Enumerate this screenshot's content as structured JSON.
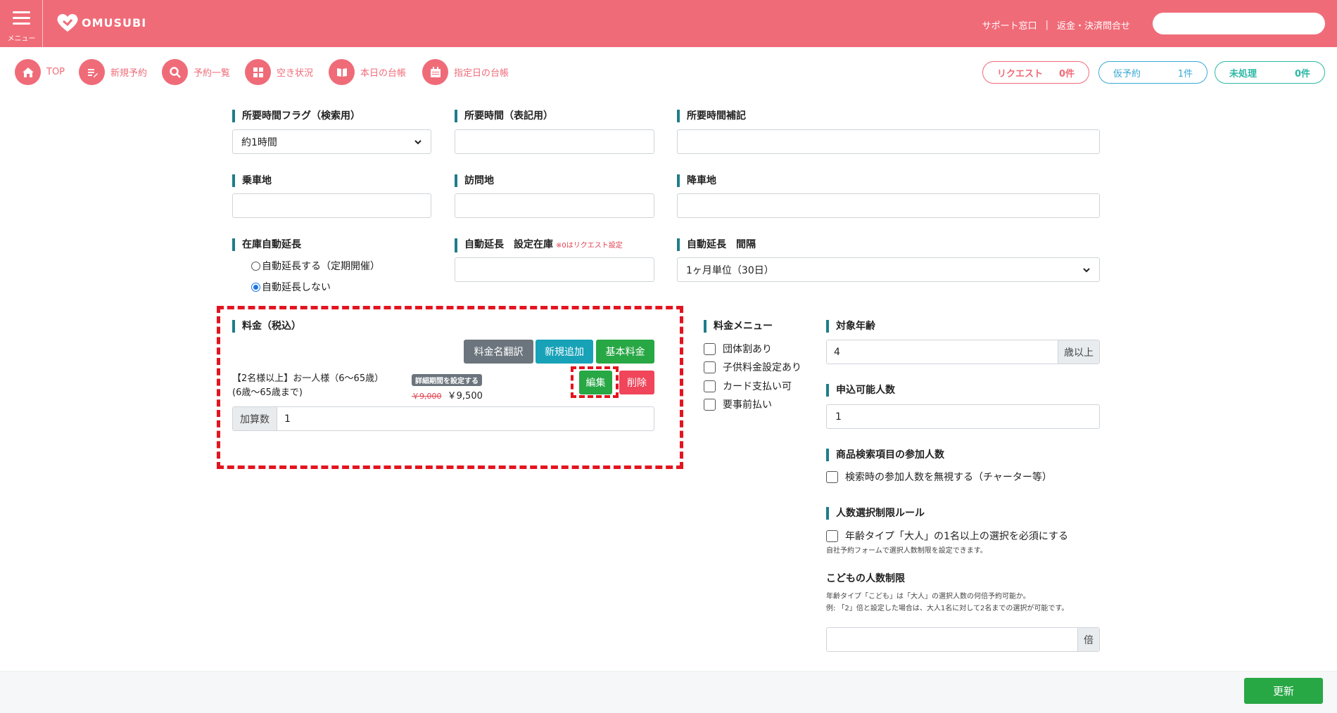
{
  "header": {
    "menu_label": "メニュー",
    "logo_text": "OMUSUBI",
    "support_link": "サポート窓口",
    "refund_link": "返金・決済問合せ",
    "search_value": "",
    "brand_color": "#f06b78"
  },
  "nav": {
    "items": [
      {
        "label": "TOP",
        "icon": "home-icon"
      },
      {
        "label": "新規予約",
        "icon": "edit-icon"
      },
      {
        "label": "予約一覧",
        "icon": "search-icon"
      },
      {
        "label": "空き状況",
        "icon": "grid-icon"
      },
      {
        "label": "本日の台帳",
        "icon": "book-icon"
      },
      {
        "label": "指定日の台帳",
        "icon": "calendar-icon"
      }
    ],
    "status": {
      "request_label": "リクエスト",
      "request_count": "0件",
      "tentative_label": "仮予約",
      "tentative_count": "1件",
      "unprocessed_label": "未処理",
      "unprocessed_count": "0件"
    }
  },
  "form": {
    "duration_flag_label": "所要時間フラグ（検索用）",
    "duration_flag_value": "約1時間",
    "duration_display_label": "所要時間（表記用）",
    "duration_display_value": "",
    "duration_note_label": "所要時間補記",
    "duration_note_value": "",
    "boarding_label": "乗車地",
    "boarding_value": "",
    "visit_label": "訪問地",
    "visit_value": "",
    "alighting_label": "降車地",
    "alighting_value": "",
    "auto_extend_label": "在庫自動延長",
    "auto_extend_on": "自動延長する（定期開催）",
    "auto_extend_off": "自動延長しない",
    "auto_stock_label": "自動延長　設定在庫",
    "auto_stock_note": "※0はリクエスト設定",
    "auto_stock_value": "",
    "auto_interval_label": "自動延長　間隔",
    "auto_interval_value": "1ヶ月単位（30日）"
  },
  "price": {
    "section_label": "料金（税込）",
    "translate_button": "料金名翻訳",
    "add_button": "新規追加",
    "base_button": "基本料金",
    "item_name": "【2名様以上】お一人様（6〜65歳）",
    "item_sub": "(6歳〜65歳まで)",
    "detail_badge": "詳細期間を設定する",
    "original_price": "￥9,000",
    "price": "￥9,500",
    "edit_button": "編集",
    "delete_button": "削除",
    "count_label": "加算数",
    "count_value": "1"
  },
  "price_menu": {
    "label": "料金メニュー",
    "options": [
      "団体割あり",
      "子供料金設定あり",
      "カード支払い可",
      "要事前払い"
    ]
  },
  "target_age": {
    "label": "対象年齢",
    "value": "4",
    "suffix": "歳以上"
  },
  "applicants": {
    "label": "申込可能人数",
    "value": "1"
  },
  "search_participants": {
    "label": "商品検索項目の参加人数",
    "option": "検索時の参加人数を無視する（チャーター等）"
  },
  "count_rule": {
    "label": "人数選択制限ルール",
    "option": "年齢タイプ「大人」の1名以上の選択を必須にする",
    "help": "自社予約フォームで選択人数制限を設定できます。"
  },
  "child_limit": {
    "label": "こどもの人数制限",
    "help1": "年齢タイプ「こども」は「大人」の選択人数の何倍予約可能か。",
    "help2": "例: 「2」倍と設定した場合は、大人1名に対して2名までの選択が可能です。",
    "value": "",
    "suffix": "倍"
  },
  "footer": {
    "update_button": "更新"
  }
}
